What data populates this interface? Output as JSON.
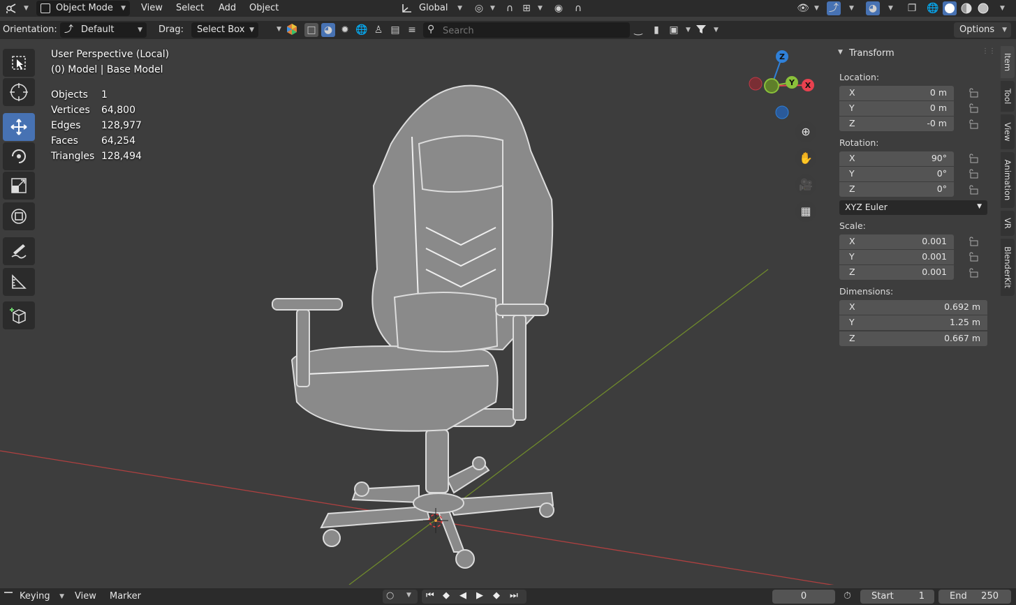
{
  "header": {
    "mode": "Object Mode",
    "menus": [
      "View",
      "Select",
      "Add",
      "Object"
    ],
    "transform_orientation": "Global",
    "options": "Options"
  },
  "tool_header": {
    "orientation_label": "Orientation:",
    "orientation_value": "Default",
    "drag_label": "Drag:",
    "drag_value": "Select Box",
    "search_placeholder": "Search"
  },
  "viewport": {
    "perspective": "User Perspective (Local)",
    "collection": "(0) Model | Base Model",
    "stats": [
      {
        "label": "Objects",
        "value": "1"
      },
      {
        "label": "Vertices",
        "value": "64,800"
      },
      {
        "label": "Edges",
        "value": "128,977"
      },
      {
        "label": "Faces",
        "value": "64,254"
      },
      {
        "label": "Triangles",
        "value": "128,494"
      }
    ],
    "gizmo": {
      "z": "Z",
      "y": "Y",
      "x": "X"
    }
  },
  "n_panel": {
    "title": "Transform",
    "location_label": "Location:",
    "location": [
      {
        "axis": "X",
        "value": "0 m"
      },
      {
        "axis": "Y",
        "value": "0 m"
      },
      {
        "axis": "Z",
        "value": "-0 m"
      }
    ],
    "rotation_label": "Rotation:",
    "rotation": [
      {
        "axis": "X",
        "value": "90°"
      },
      {
        "axis": "Y",
        "value": "0°"
      },
      {
        "axis": "Z",
        "value": "0°"
      }
    ],
    "rotation_mode": "XYZ Euler",
    "scale_label": "Scale:",
    "scale": [
      {
        "axis": "X",
        "value": "0.001"
      },
      {
        "axis": "Y",
        "value": "0.001"
      },
      {
        "axis": "Z",
        "value": "0.001"
      }
    ],
    "dimensions_label": "Dimensions:",
    "dimensions": [
      {
        "axis": "X",
        "value": "0.692 m"
      },
      {
        "axis": "Y",
        "value": "1.25 m"
      },
      {
        "axis": "Z",
        "value": "0.667 m"
      }
    ],
    "tabs": [
      "Item",
      "Tool",
      "View",
      "Animation",
      "VR",
      "BlenderKit"
    ]
  },
  "timeline": {
    "keying": "Keying",
    "view": "View",
    "marker": "Marker",
    "current_frame": "0",
    "start_label": "Start",
    "start_value": "1",
    "end_label": "End",
    "end_value": "250"
  },
  "colors": {
    "accent": "#4772b3",
    "axis_x": "#e8414f",
    "axis_y": "#8ac13a",
    "axis_z": "#2f80d8"
  }
}
